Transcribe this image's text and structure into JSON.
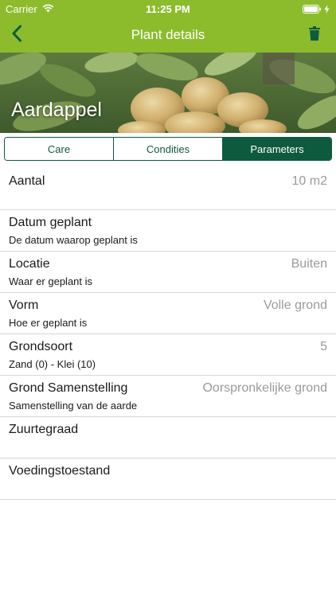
{
  "status_bar": {
    "carrier": "Carrier",
    "time": "11:25 PM",
    "wifi_icon": "wifi-icon",
    "battery_icon": "battery-icon"
  },
  "nav": {
    "title": "Plant details",
    "back_icon": "chevron-left-icon",
    "delete_icon": "trash-icon"
  },
  "hero": {
    "title": "Aardappel"
  },
  "tabs": [
    {
      "label": "Care",
      "active": false
    },
    {
      "label": "Condities",
      "active": false
    },
    {
      "label": "Parameters",
      "active": true
    }
  ],
  "rows": [
    {
      "label": "Aantal",
      "sub": "",
      "value": "10 m2"
    },
    {
      "label": "Datum geplant",
      "sub": "De datum waarop geplant is",
      "value": ""
    },
    {
      "label": "Locatie",
      "sub": "Waar er geplant is",
      "value": "Buiten"
    },
    {
      "label": "Vorm",
      "sub": "Hoe er geplant is",
      "value": "Volle grond"
    },
    {
      "label": "Grondsoort",
      "sub": "Zand (0) - Klei (10)",
      "value": "5"
    },
    {
      "label": "Grond Samenstelling",
      "sub": "Samenstelling van de aarde",
      "value": "Oorspronkelijke grond"
    },
    {
      "label": "Zuurtegraad",
      "sub": "",
      "value": ""
    },
    {
      "label": "Voedingstoestand",
      "sub": "",
      "value": ""
    }
  ],
  "colors": {
    "header_green": "#8cbc2c",
    "tab_dark_green": "#0e5a3f",
    "value_grey": "#9a9a9a"
  }
}
